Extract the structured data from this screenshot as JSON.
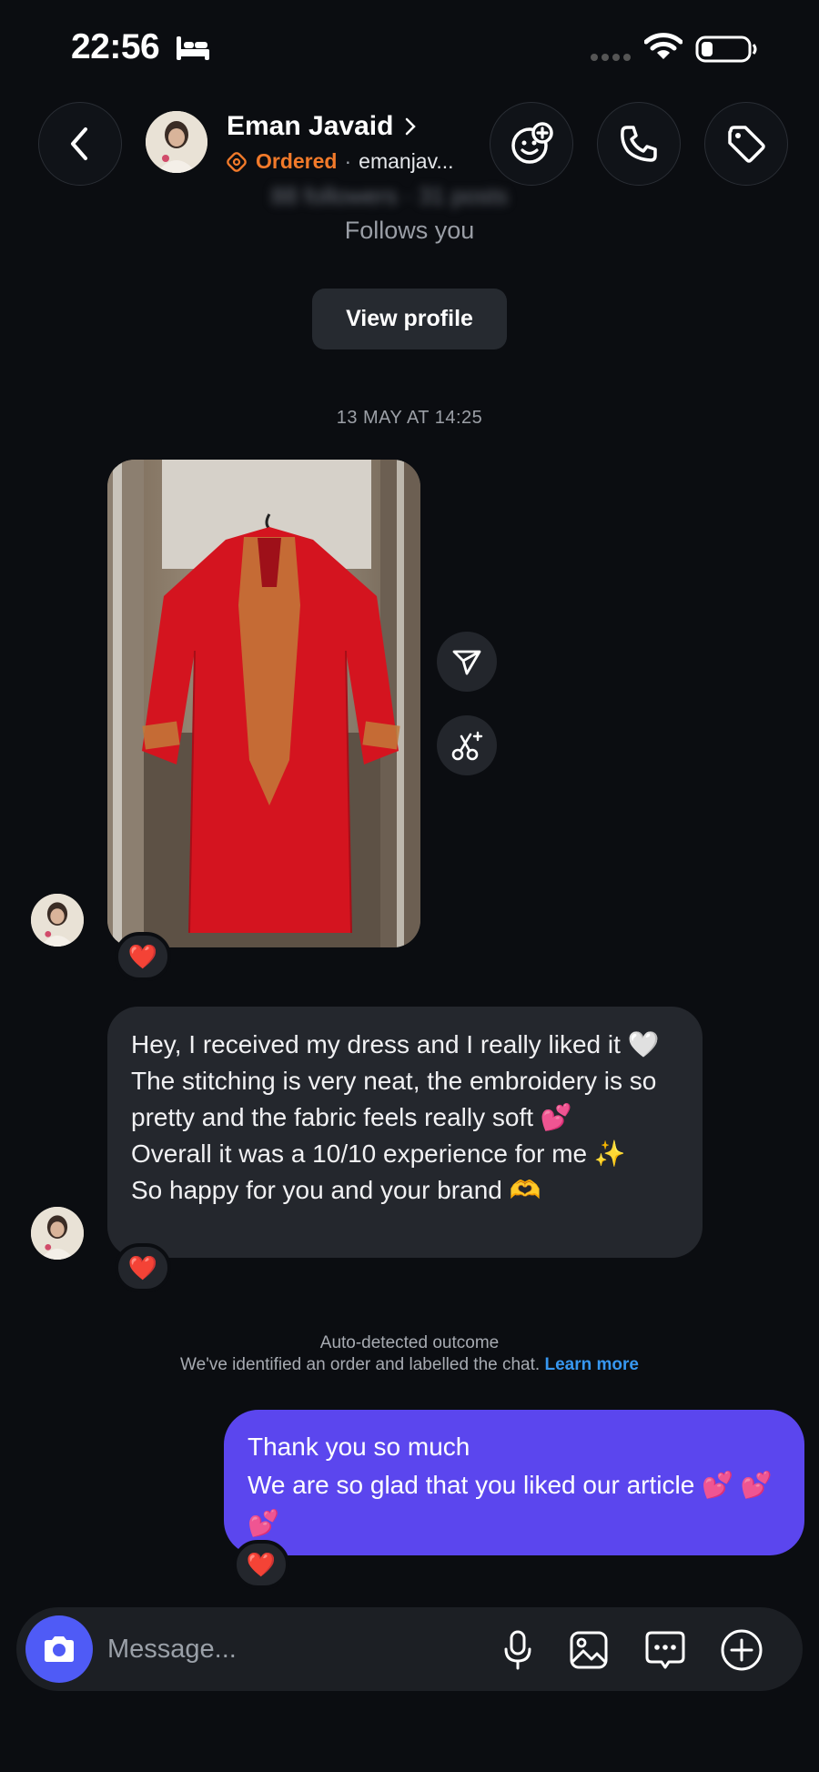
{
  "status_bar": {
    "time": "22:56"
  },
  "header": {
    "contact_name": "Eman Javaid",
    "status_label": "Ordered",
    "separator": "·",
    "username": "emanjav...",
    "profile_stats": "88 followers · 31 posts"
  },
  "profile_card": {
    "follows_you": "Follows you",
    "view_profile_label": "View profile"
  },
  "conversation": {
    "date_stamp": "13 MAY AT 14:25",
    "image_reaction": "❤️",
    "incoming_message": {
      "lines": [
        "Hey, I received my dress and I really liked it 🤍",
        "The stitching is very neat, the embroidery is so pretty and the fabric feels really soft 💕",
        "Overall it was a 10/10 experience for me ✨",
        "So happy for you and your brand 🫶"
      ],
      "reaction": "❤️"
    },
    "outcome_notice": {
      "title": "Auto-detected outcome",
      "text": "We've identified an order and labelled the chat.",
      "link": "Learn more"
    },
    "outgoing_message": {
      "lines": [
        "Thank you so much",
        "We are so glad that you liked our article 💕 💕 💕"
      ],
      "reaction": "❤️"
    }
  },
  "composer": {
    "placeholder": "Message..."
  },
  "colors": {
    "background": "#0b0d11",
    "incoming_bubble": "#24272d",
    "outgoing_bubble": "#5b46ee",
    "ordered_accent": "#f27a2a",
    "link": "#3797f0",
    "camera_button": "#4f5bf6"
  },
  "icons": [
    "bed-icon",
    "wifi-icon",
    "battery-icon",
    "back-icon",
    "effects-icon",
    "phone-icon",
    "tag-icon",
    "share-icon",
    "remix-icon",
    "camera-icon",
    "mic-icon",
    "gallery-icon",
    "sticker-icon",
    "plus-icon"
  ]
}
